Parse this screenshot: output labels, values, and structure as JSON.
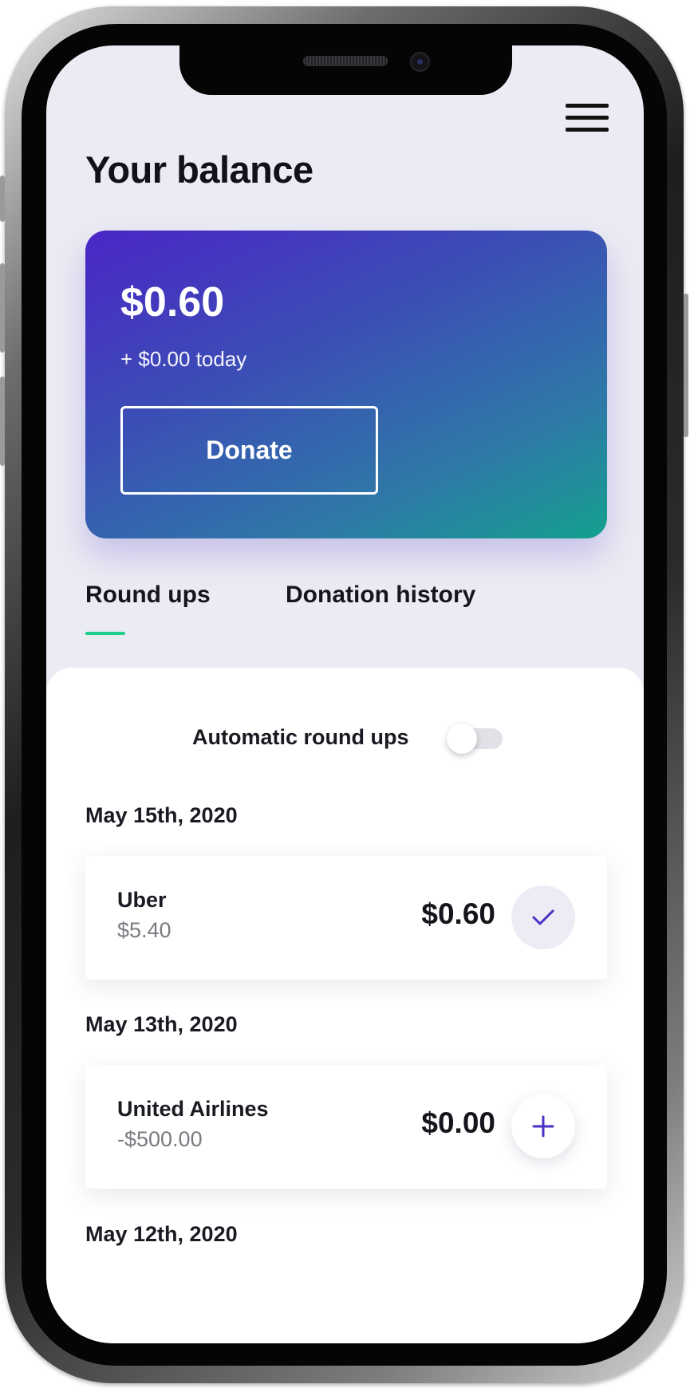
{
  "header": {
    "title": "Your balance",
    "menu_icon": "hamburger-menu-icon"
  },
  "balance_card": {
    "amount": "$0.60",
    "today": "+ $0.00 today",
    "donate_label": "Donate",
    "gradient_colors": [
      "#4a26c6",
      "#3b4fb5",
      "#2e7aa7",
      "#14a08e"
    ]
  },
  "tabs": [
    {
      "label": "Round ups",
      "active": true
    },
    {
      "label": "Donation history",
      "active": false
    }
  ],
  "accent_color": "#1fce8a",
  "automatic_round_ups": {
    "label": "Automatic round ups",
    "enabled": false
  },
  "groups": [
    {
      "date": "May 15th, 2020",
      "transactions": [
        {
          "merchant": "Uber",
          "amount": "$5.40",
          "round_up": "$0.60",
          "status": "checked",
          "icon": "checkmark-icon"
        }
      ]
    },
    {
      "date": "May 13th, 2020",
      "transactions": [
        {
          "merchant": "United Airlines",
          "amount": "-$500.00",
          "round_up": "$0.00",
          "status": "add",
          "icon": "plus-icon"
        }
      ]
    },
    {
      "date": "May 12th, 2020",
      "transactions": []
    }
  ]
}
